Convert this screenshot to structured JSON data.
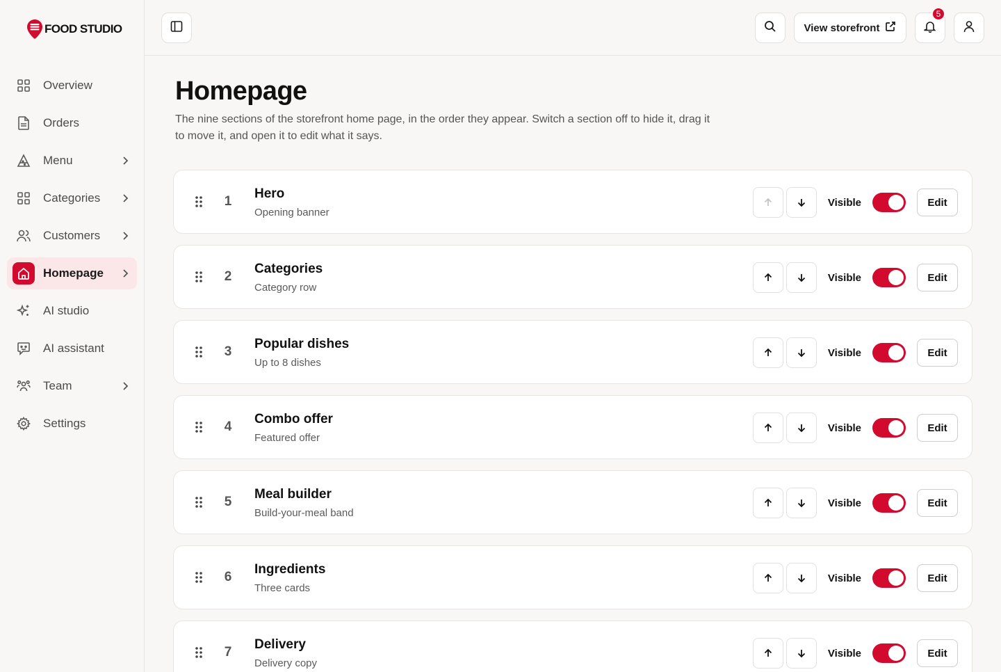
{
  "brand": {
    "logo_text": "FOOD STUDIO",
    "accent": "#d10a2e"
  },
  "sidebar": {
    "items": [
      {
        "label": "Overview",
        "icon": "grid-icon",
        "chevron": false,
        "active": false
      },
      {
        "label": "Orders",
        "icon": "document-icon",
        "chevron": false,
        "active": false
      },
      {
        "label": "Menu",
        "icon": "pizza-slice-icon",
        "chevron": true,
        "active": false
      },
      {
        "label": "Categories",
        "icon": "grid-icon",
        "chevron": true,
        "active": false
      },
      {
        "label": "Customers",
        "icon": "users-icon",
        "chevron": true,
        "active": false
      },
      {
        "label": "Homepage",
        "icon": "home-icon",
        "chevron": true,
        "active": true
      },
      {
        "label": "AI studio",
        "icon": "sparkle-icon",
        "chevron": false,
        "active": false
      },
      {
        "label": "AI assistant",
        "icon": "chat-bot-icon",
        "chevron": false,
        "active": false
      },
      {
        "label": "Team",
        "icon": "team-icon",
        "chevron": true,
        "active": false
      },
      {
        "label": "Settings",
        "icon": "gear-icon",
        "chevron": false,
        "active": false
      }
    ]
  },
  "topbar": {
    "view_storefront_label": "View storefront",
    "notifications_count": "5"
  },
  "page": {
    "title": "Homepage",
    "description": "The nine sections of the storefront home page, in the order they appear. Switch a section off to hide it, drag it to move it, and open it to edit what it says."
  },
  "sections": [
    {
      "number": "1",
      "title": "Hero",
      "subtitle": "Opening banner",
      "visible_label": "Visible",
      "visible": true,
      "edit_label": "Edit",
      "up_disabled": true
    },
    {
      "number": "2",
      "title": "Categories",
      "subtitle": "Category row",
      "visible_label": "Visible",
      "visible": true,
      "edit_label": "Edit",
      "up_disabled": false
    },
    {
      "number": "3",
      "title": "Popular dishes",
      "subtitle": "Up to 8 dishes",
      "visible_label": "Visible",
      "visible": true,
      "edit_label": "Edit",
      "up_disabled": false
    },
    {
      "number": "4",
      "title": "Combo offer",
      "subtitle": "Featured offer",
      "visible_label": "Visible",
      "visible": true,
      "edit_label": "Edit",
      "up_disabled": false
    },
    {
      "number": "5",
      "title": "Meal builder",
      "subtitle": "Build-your-meal band",
      "visible_label": "Visible",
      "visible": true,
      "edit_label": "Edit",
      "up_disabled": false
    },
    {
      "number": "6",
      "title": "Ingredients",
      "subtitle": "Three cards",
      "visible_label": "Visible",
      "visible": true,
      "edit_label": "Edit",
      "up_disabled": false
    },
    {
      "number": "7",
      "title": "Delivery",
      "subtitle": "Delivery copy",
      "visible_label": "Visible",
      "visible": true,
      "edit_label": "Edit",
      "up_disabled": false
    }
  ]
}
